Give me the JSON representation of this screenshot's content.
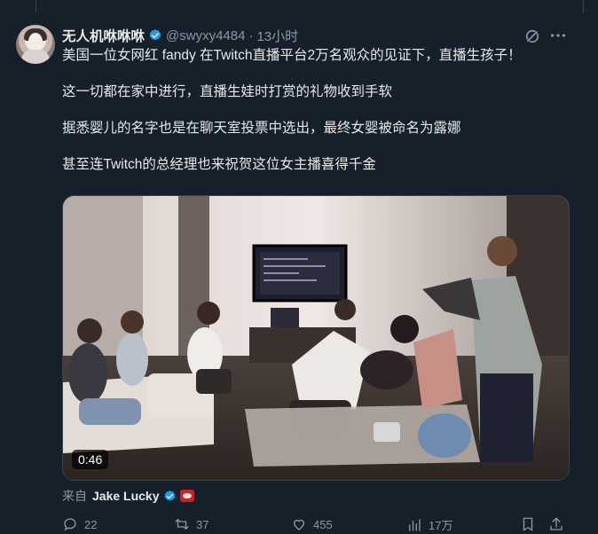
{
  "tweet": {
    "display_name": "无人机咻咻咻",
    "handle": "@swyxy4484",
    "separator": "·",
    "time": "13小时",
    "paragraphs": [
      "美国一位女网红 fandy 在Twitch直播平台2万名观众的见证下，直播生孩子！",
      "这一切都在家中进行，直播生娃时打赏的礼物收到手软",
      "据悉婴儿的名字也是在聊天室投票中选出，最终女婴被命名为露娜",
      "甚至连Twitch的总经理也来祝贺这位女主播喜得千金"
    ],
    "media": {
      "duration": "0:46"
    },
    "source": {
      "prefix": "来自",
      "name": "Jake Lucky"
    },
    "actions": {
      "replies": "22",
      "reposts": "37",
      "likes": "455",
      "views": "17万"
    }
  },
  "colors": {
    "background": "#15202b",
    "text": "#e7e9ea",
    "muted": "#8b98a5",
    "verified": "#1d9bf0"
  },
  "icons": [
    "verified-badge-icon",
    "grok-icon",
    "more-icon",
    "reply-icon",
    "repost-icon",
    "like-icon",
    "views-icon",
    "bookmark-icon",
    "share-icon"
  ]
}
